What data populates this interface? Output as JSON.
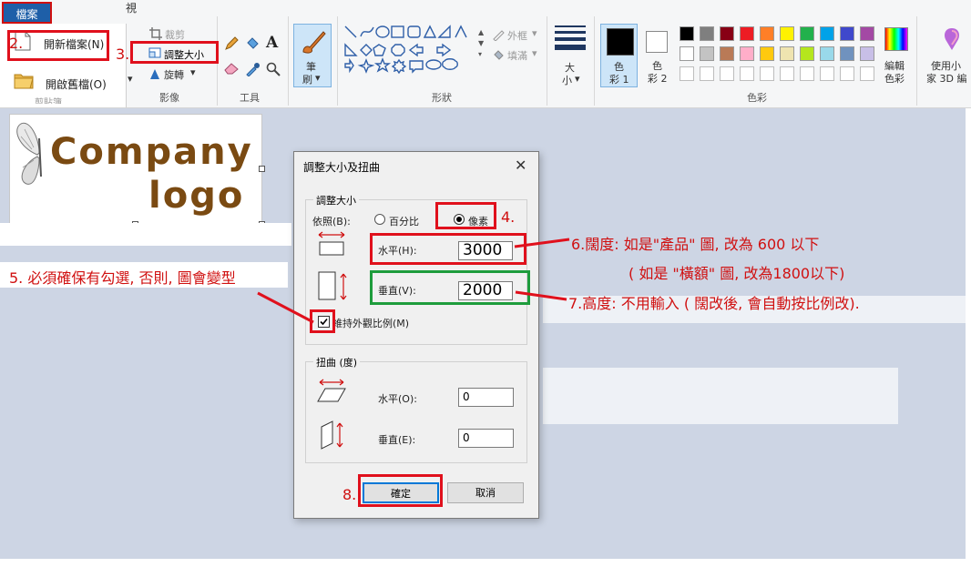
{
  "ribbon": {
    "file_tab": "檔案",
    "view_tab": "視",
    "image_group": {
      "crop": "裁剪",
      "resize": "調整大小",
      "rotate": "旋轉",
      "label": "影像"
    },
    "tools_label": "工具",
    "brush_label_1": "筆",
    "brush_label_2": "刷",
    "shapes": {
      "outline": "外框",
      "fill": "填滿",
      "label": "形狀"
    },
    "size_label_1": "大",
    "size_label_2": "小",
    "color1_label_1": "色",
    "color1_label_2": "彩 1",
    "color2_label_1": "色",
    "color2_label_2": "彩 2",
    "edit_colors_1": "編輯",
    "edit_colors_2": "色彩",
    "colors_label": "色彩",
    "paint3d_1": "使用小",
    "paint3d_2": "家 3D 編",
    "palette_row1": [
      "#000000",
      "#7f7f7f",
      "#880015",
      "#ed1c24",
      "#ff7f27",
      "#fff200",
      "#22b14c",
      "#00a2e8",
      "#3f48cc",
      "#a349a4"
    ],
    "palette_row2": [
      "#ffffff",
      "#c3c3c3",
      "#b97a57",
      "#ffaec9",
      "#ffc90e",
      "#efe4b0",
      "#b5e61d",
      "#99d9ea",
      "#7092be",
      "#c8bfe7"
    ]
  },
  "file_menu": {
    "new": "開新檔案(N)",
    "open": "開啟舊檔(O)",
    "partial": "剪貼簿"
  },
  "logo": {
    "line1": "Company",
    "line2": "logo"
  },
  "dialog": {
    "title": "調整大小及扭曲",
    "close": "✕",
    "resize_group": "調整大小",
    "by": "依照(B):",
    "percent": "百分比",
    "pixels": "像素",
    "horizontal_label": "水平(H):",
    "horizontal_value": "3000",
    "vertical_label": "垂直(V):",
    "vertical_value": "2000",
    "keep_ratio": "維持外觀比例(M)",
    "skew_group": "扭曲 (度)",
    "skew_h_label": "水平(O):",
    "skew_h_value": "0",
    "skew_v_label": "垂直(E):",
    "skew_v_value": "0",
    "ok": "確定",
    "cancel": "取消"
  },
  "annotations": {
    "step2": "2.",
    "step3": "3.",
    "step4": "4.",
    "step5": "5. 必須確保有勾選, 否則, 圖會變型",
    "step6_line1": "6.闊度: 如是\"產品\" 圖,  改為 600 以下",
    "step6_line2": "( 如是 \"橫額\" 圖, 改為1800以下)",
    "step7": "7.高度:  不用輸入 ( 闊改後, 會自動按比例改).",
    "step8": "8."
  },
  "colors": {
    "annotation_red": "#e0101c",
    "annotation_green": "#1e9c3c",
    "workspace": "#cdd5e4",
    "logo_brown": "#7a4a12"
  }
}
